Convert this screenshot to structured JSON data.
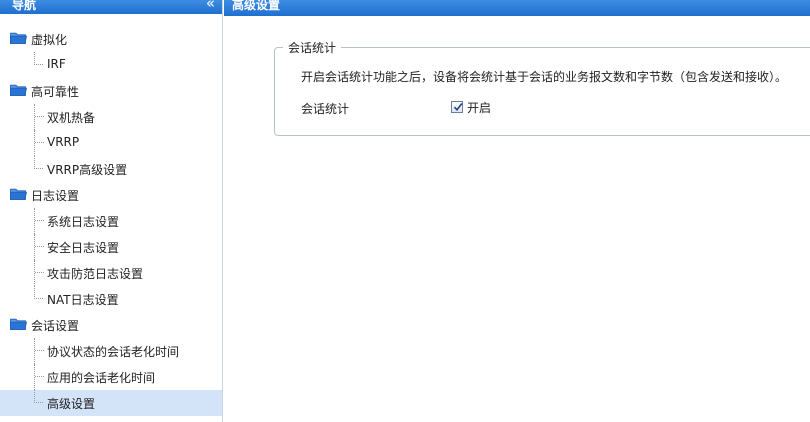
{
  "nav": {
    "title": "导航",
    "collapse_icon": "double-chevron-left-icon",
    "groups": [
      {
        "label": "虚拟化",
        "items": [
          "IRF"
        ]
      },
      {
        "label": "高可靠性",
        "items": [
          "双机热备",
          "VRRP",
          "VRRP高级设置"
        ]
      },
      {
        "label": "日志设置",
        "items": [
          "系统日志设置",
          "安全日志设置",
          "攻击防范日志设置",
          "NAT日志设置"
        ]
      },
      {
        "label": "会话设置",
        "items": [
          "协议状态的会话老化时间",
          "应用的会话老化时间",
          "高级设置"
        ]
      }
    ],
    "active_item": "高级设置"
  },
  "main": {
    "title": "高级设置",
    "section": {
      "legend": "会话统计",
      "description": "开启会话统计功能之后，设备将会统计基于会话的业务报文数和字节数（包含发送和接收）。",
      "field_label": "会话统计",
      "checkbox_label": "开启",
      "checkbox_checked": true
    }
  },
  "colors": {
    "header_blue": "#1f6fd0",
    "folder_blue": "#2a74d3",
    "active_bg": "#d3e3f8"
  }
}
